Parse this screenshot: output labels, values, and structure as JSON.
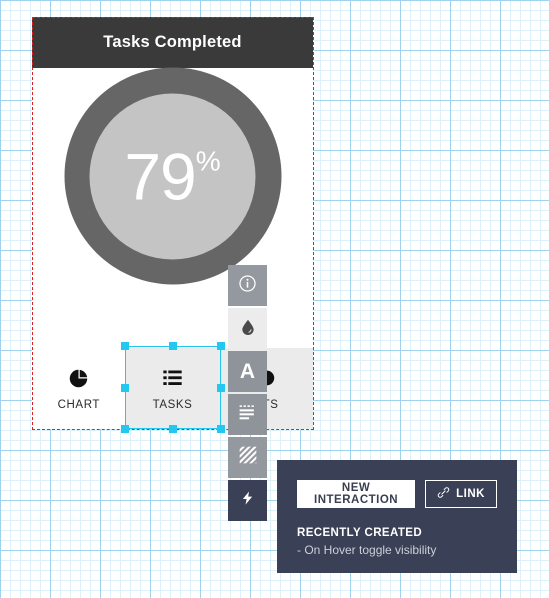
{
  "card": {
    "header_title": "Tasks Completed",
    "donut": {
      "value": "79",
      "unit": "%",
      "ring_color": "#666666",
      "inner_color": "#c4c4c4"
    },
    "tabs": [
      {
        "label": "CHART",
        "icon": "pie-chart-icon",
        "selected": false
      },
      {
        "label": "TASKS",
        "icon": "list-icon",
        "selected": true
      },
      {
        "label": "NTS",
        "icon": "rounded-shape-icon",
        "selected": false
      }
    ]
  },
  "toolbar": {
    "buttons": [
      {
        "icon": "info-circle-icon",
        "glyph": "i"
      },
      {
        "icon": "ink-drop-icon",
        "glyph": "drop"
      },
      {
        "icon": "text-format-icon",
        "glyph": "A"
      },
      {
        "icon": "list-lines-icon",
        "glyph": "lines"
      },
      {
        "icon": "hatch-pattern-icon",
        "glyph": "hatch"
      },
      {
        "icon": "lightning-bolt-icon",
        "glyph": "bolt"
      }
    ]
  },
  "panel": {
    "new_interaction_label": "NEW INTERACTION",
    "link_label": "LINK",
    "link_icon": "link-icon",
    "section_title": "RECENTLY CREATED",
    "item_text": "- On Hover toggle visibility",
    "background_color": "#3a4055"
  }
}
